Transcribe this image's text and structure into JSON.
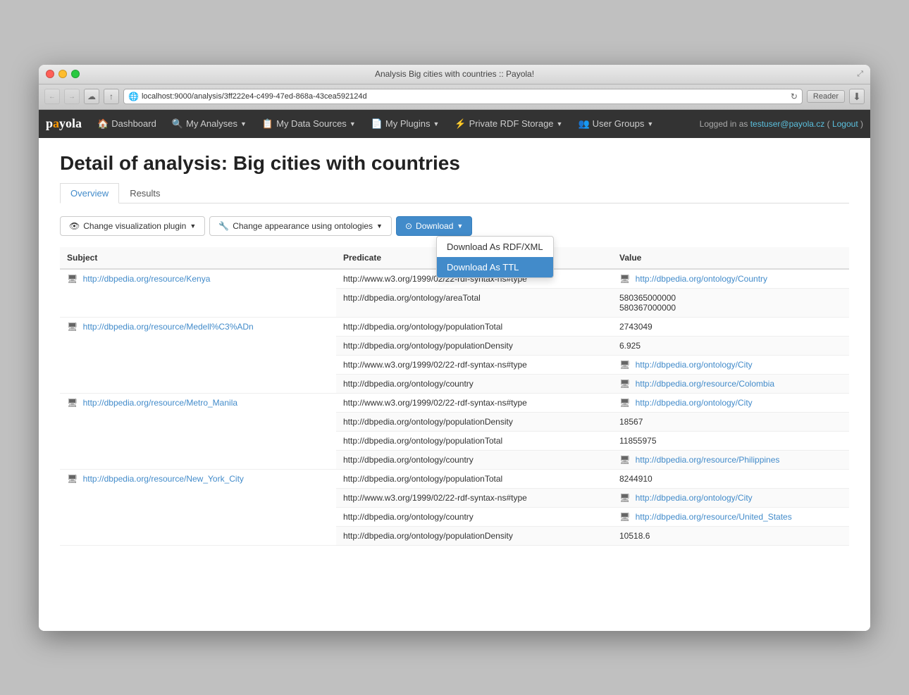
{
  "window": {
    "title": "Analysis Big cities with countries :: Payola!",
    "url": "localhost:9000/analysis/3ff222e4-c499-47ed-868a-43cea592124d"
  },
  "navbar": {
    "brand": "payola",
    "items": [
      {
        "label": "Dashboard",
        "icon": "🏠",
        "hasDropdown": false
      },
      {
        "label": "My Analyses",
        "icon": "🔍",
        "hasDropdown": true
      },
      {
        "label": "My Data Sources",
        "icon": "📋",
        "hasDropdown": true
      },
      {
        "label": "My Plugins",
        "icon": "📄",
        "hasDropdown": true
      },
      {
        "label": "Private RDF Storage",
        "icon": "⚡",
        "hasDropdown": true
      },
      {
        "label": "User Groups",
        "icon": "👥",
        "hasDropdown": true
      }
    ],
    "logged_in_text": "Logged in as ",
    "user": "testuser@payola.cz",
    "logout_label": "Logout"
  },
  "page": {
    "title": "Detail of analysis: Big cities with countries",
    "tabs": [
      {
        "label": "Overview",
        "active": true
      },
      {
        "label": "Results",
        "active": false
      }
    ]
  },
  "toolbar": {
    "viz_plugin_label": " Change visualization plugin",
    "ontology_label": " Change appearance using ontologies",
    "download_label": "Download",
    "download_items": [
      {
        "label": "Download As RDF/XML",
        "active": false
      },
      {
        "label": "Download As TTL",
        "active": true
      }
    ]
  },
  "table": {
    "columns": [
      "Subject",
      "Predicate",
      "Value"
    ],
    "rows": [
      {
        "subject": "http://dbpedia.org/resource/Kenya",
        "subject_link": true,
        "predicates": [
          {
            "predicate": "http://www.w3.org/1999/02/22-rdf-syntax-ns#type",
            "value": "http://dbpedia.org/ontology/Country",
            "value_link": true
          },
          {
            "predicate": "http://dbpedia.org/ontology/areaTotal",
            "value": "580365000000\n580367000000",
            "value_link": false
          }
        ]
      },
      {
        "subject": "http://dbpedia.org/resource/Medell%C3%ADn",
        "subject_link": true,
        "predicates": [
          {
            "predicate": "http://dbpedia.org/ontology/populationTotal",
            "value": "2743049",
            "value_link": false
          },
          {
            "predicate": "http://dbpedia.org/ontology/populationDensity",
            "value": "6.925",
            "value_link": false
          },
          {
            "predicate": "http://www.w3.org/1999/02/22-rdf-syntax-ns#type",
            "value": "http://dbpedia.org/ontology/City",
            "value_link": true
          },
          {
            "predicate": "http://dbpedia.org/ontology/country",
            "value": "http://dbpedia.org/resource/Colombia",
            "value_link": true
          }
        ]
      },
      {
        "subject": "http://dbpedia.org/resource/Metro_Manila",
        "subject_link": true,
        "predicates": [
          {
            "predicate": "http://www.w3.org/1999/02/22-rdf-syntax-ns#type",
            "value": "http://dbpedia.org/ontology/City",
            "value_link": true
          },
          {
            "predicate": "http://dbpedia.org/ontology/populationDensity",
            "value": "18567",
            "value_link": false
          },
          {
            "predicate": "http://dbpedia.org/ontology/populationTotal",
            "value": "11855975",
            "value_link": false
          },
          {
            "predicate": "http://dbpedia.org/ontology/country",
            "value": "http://dbpedia.org/resource/Philippines",
            "value_link": true
          }
        ]
      },
      {
        "subject": "http://dbpedia.org/resource/New_York_City",
        "subject_link": true,
        "predicates": [
          {
            "predicate": "http://dbpedia.org/ontology/populationTotal",
            "value": "8244910",
            "value_link": false
          },
          {
            "predicate": "http://www.w3.org/1999/02/22-rdf-syntax-ns#type",
            "value": "http://dbpedia.org/ontology/City",
            "value_link": true
          },
          {
            "predicate": "http://dbpedia.org/ontology/country",
            "value": "http://dbpedia.org/resource/United_States",
            "value_link": true
          },
          {
            "predicate": "http://dbpedia.org/ontology/populationDensity",
            "value": "10518.6",
            "value_link": false
          }
        ]
      }
    ]
  }
}
